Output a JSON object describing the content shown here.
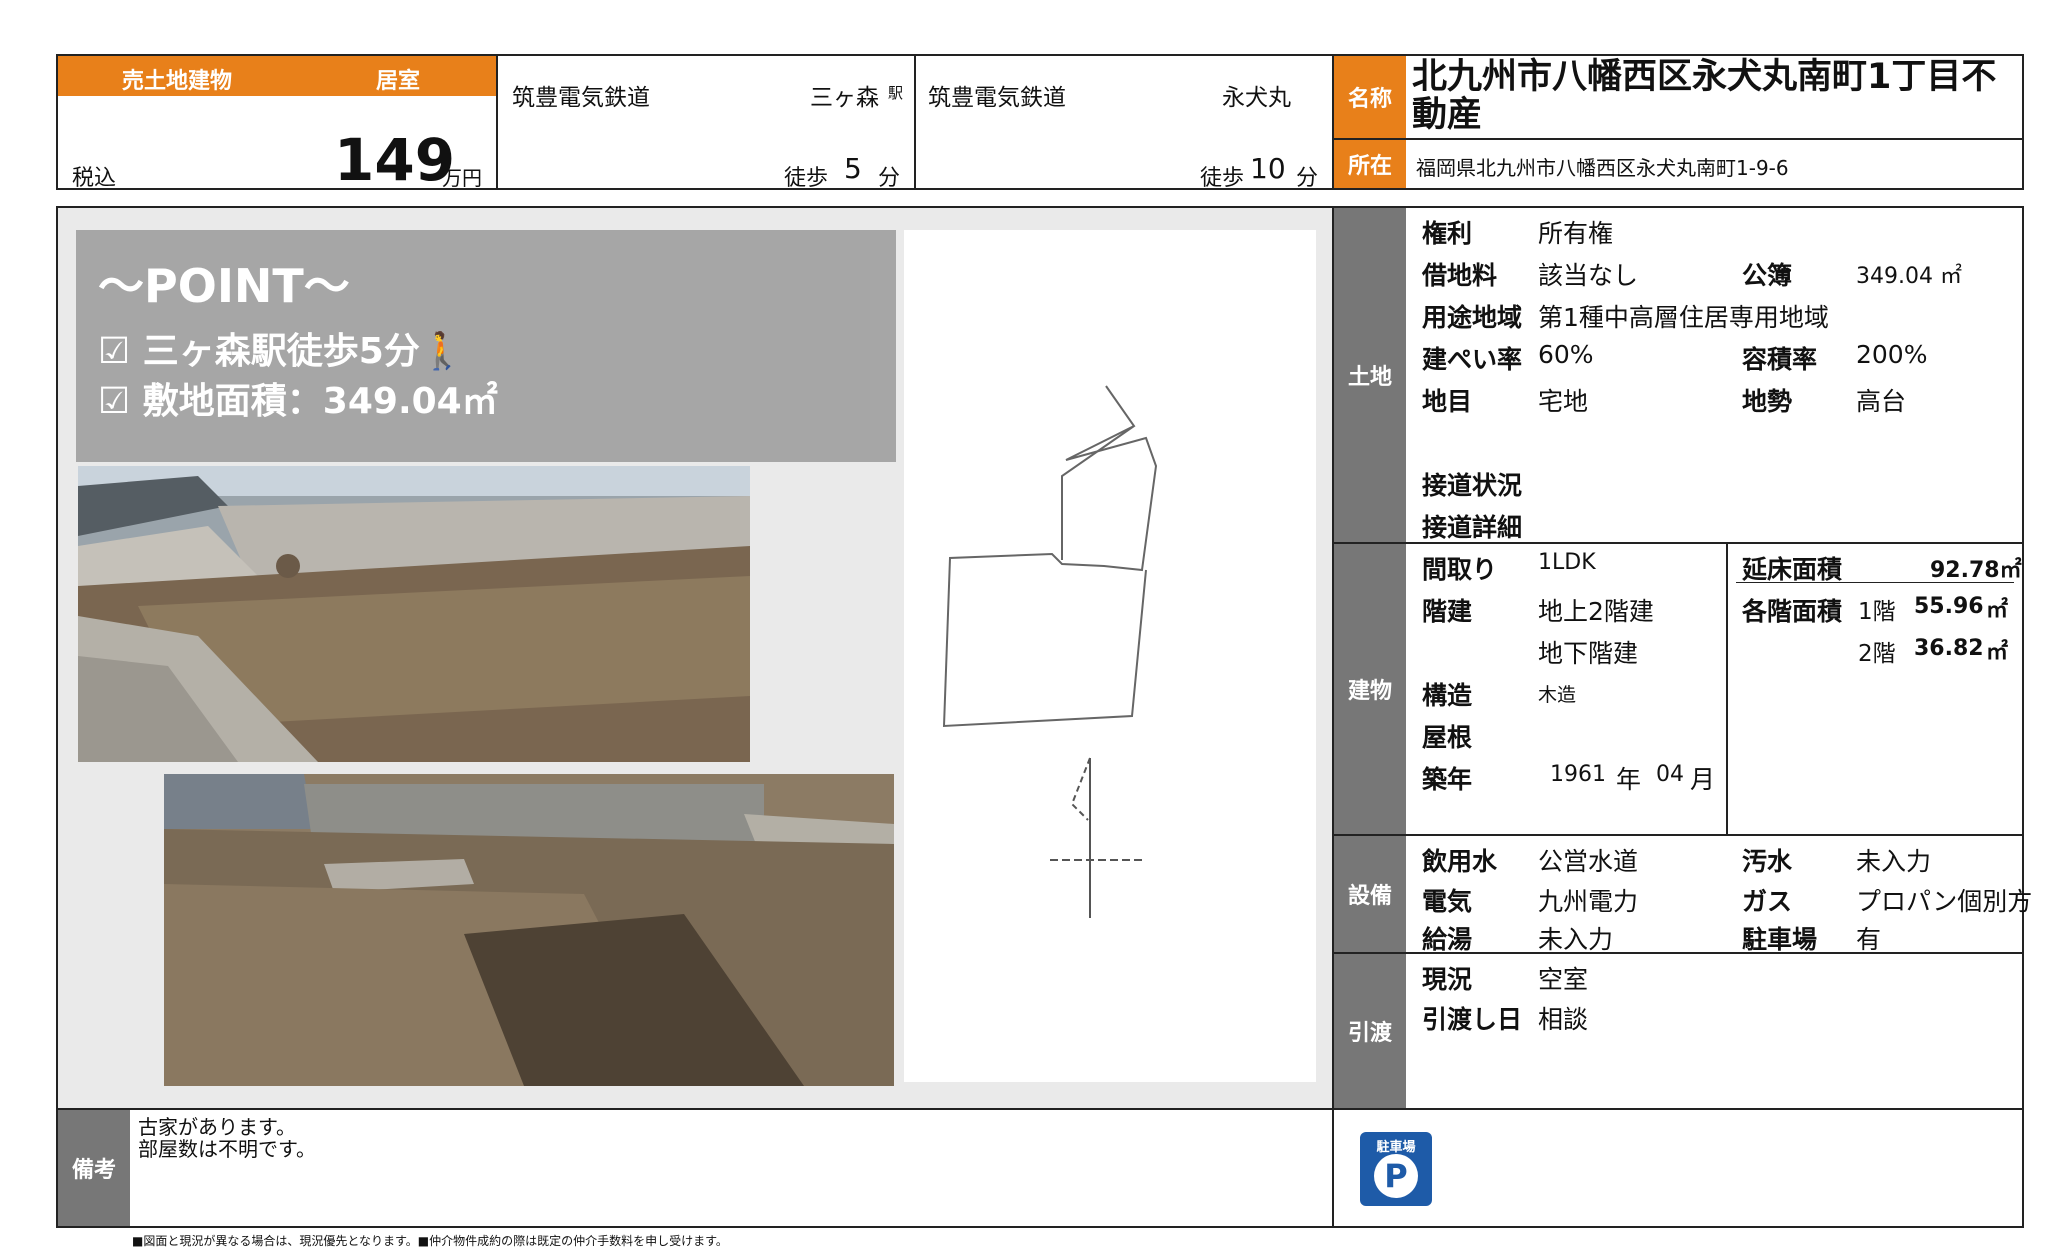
{
  "header": {
    "category_left": "売土地建物",
    "category_right": "居室",
    "tax_label": "税込",
    "price": "149",
    "price_unit": "万円",
    "station1": {
      "line": "筑豊電気鉄道",
      "name": "三ヶ森",
      "suffix": "駅",
      "walk_label": "徒歩",
      "walk_min": "5",
      "min_unit": "分"
    },
    "station2": {
      "line": "筑豊電気鉄道",
      "name": "永犬丸",
      "walk_label": "徒歩",
      "walk_min": "10",
      "min_unit": "分"
    },
    "name_label": "名称",
    "name_value": "北九州市八幡西区永犬丸南町1丁目不動産",
    "location_label": "所在",
    "location_value": "福岡県北九州市八幡西区永犬丸南町1-9-6"
  },
  "point": {
    "title": "～POINT～",
    "item1": "☑ 三ヶ森駅徒歩5分🚶",
    "item2": "☑ 敷地面積：349.04㎡"
  },
  "land": {
    "section": "土地",
    "rights_label": "権利",
    "rights_value": "所有権",
    "leasefee_label": "借地料",
    "leasefee_value": "該当なし",
    "registry_label": "公簿",
    "registry_value": "349.04 ㎡",
    "zoning_label": "用途地域",
    "zoning_value": "第1種中高層住居専用地域",
    "coverage_label": "建ぺい率",
    "coverage_value": "60%",
    "far_label": "容積率",
    "far_value": "200%",
    "landcat_label": "地目",
    "landcat_value": "宅地",
    "terrain_label": "地勢",
    "terrain_value": "高台",
    "road_status_label": "接道状況",
    "road_detail_label": "接道詳細"
  },
  "building": {
    "section": "建物",
    "layout_label": "間取り",
    "layout_value": "1LDK",
    "floors_label": "階建",
    "floors_above": "地上2階建",
    "floors_below": "地下階建",
    "structure_label": "構造",
    "structure_value": "木造",
    "roof_label": "屋根",
    "built_label": "築年",
    "built_year": "1961",
    "year_unit": "年",
    "built_month": "04",
    "month_unit": "月",
    "total_area_label": "延床面積",
    "total_area_value": "92.78㎡",
    "floor_area_label": "各階面積",
    "f1_label": "1階",
    "f1_value": "55.96",
    "f2_label": "2階",
    "f2_value": "36.82",
    "area_unit": "㎡"
  },
  "facility": {
    "section": "設備",
    "water_label": "飲用水",
    "water_value": "公営水道",
    "sewage_label": "汚水",
    "sewage_value": "未入力",
    "electric_label": "電気",
    "electric_value": "九州電力",
    "gas_label": "ガス",
    "gas_value": "プロパン個別方",
    "hotwater_label": "給湯",
    "hotwater_value": "未入力",
    "parking_label": "駐車場",
    "parking_value": "有"
  },
  "delivery": {
    "section": "引渡",
    "status_label": "現況",
    "status_value": "空室",
    "date_label": "引渡し日",
    "date_value": "相談"
  },
  "remarks": {
    "label": "備考",
    "line1": "古家があります。",
    "line2": "部屋数は不明です。"
  },
  "parking_badge": {
    "top": "駐車場",
    "letter": "P"
  },
  "footer_note": "■図面と現況が異なる場合は、現況優先となります。■仲介物件成約の際は既定の仲介手数料を申し受けます。",
  "colors": {
    "accent": "#e8801a",
    "label_gray": "#777777",
    "parking_blue": "#1e5ba8"
  }
}
